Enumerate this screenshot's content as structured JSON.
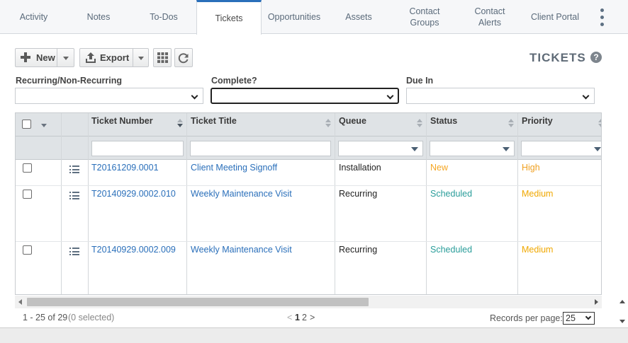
{
  "tabs": [
    {
      "label": "Activity"
    },
    {
      "label": "Notes"
    },
    {
      "label": "To-Dos"
    },
    {
      "label": "Tickets"
    },
    {
      "label": "Opportunities"
    },
    {
      "label": "Assets"
    },
    {
      "label": "Contact Groups"
    },
    {
      "label": "Contact Alerts"
    },
    {
      "label": "Client Portal"
    }
  ],
  "toolbar": {
    "new_label": "New",
    "export_label": "Export"
  },
  "page_title": "TICKETS",
  "help_glyph": "?",
  "filters": [
    {
      "label": "Recurring/Non-Recurring",
      "value": ""
    },
    {
      "label": "Complete?",
      "value": ""
    },
    {
      "label": "Due In",
      "value": ""
    }
  ],
  "columns": [
    "Ticket Number",
    "Ticket Title",
    "Queue",
    "Status",
    "Priority"
  ],
  "rows": [
    {
      "number": "T20161209.0001",
      "title": "Client Meeting Signoff",
      "queue": "Installation",
      "status": "New",
      "priority": "High"
    },
    {
      "number": "T20140929.0002.010",
      "title": "Weekly Maintenance Visit",
      "queue": "Recurring",
      "status": "Scheduled",
      "priority": "Medium"
    },
    {
      "number": "T20140929.0002.009",
      "title": "Weekly Maintenance Visit",
      "queue": "Recurring",
      "status": "Scheduled",
      "priority": "Medium"
    }
  ],
  "colors": {
    "accent": "#2a6fba",
    "status_new": "#f5a623",
    "status_scheduled": "#2a9d9a",
    "priority_high": "#f5a623",
    "priority_medium": "#f0a800"
  },
  "footer": {
    "range": "1 - 25 of 29",
    "selected": "(0 selected)",
    "prev": "<",
    "page_current": "1",
    "page_next": "2",
    "next": ">",
    "records_label": "Records per page:",
    "records_value": "25"
  }
}
